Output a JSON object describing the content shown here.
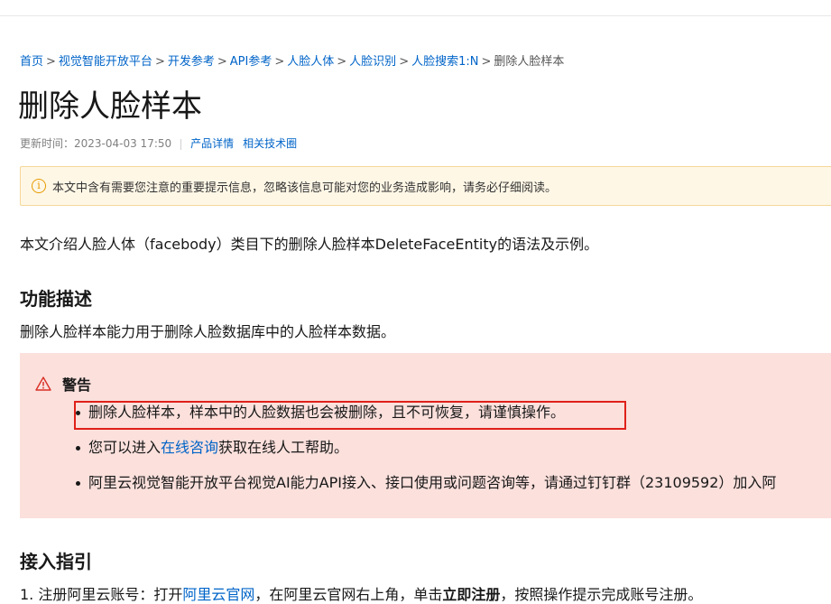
{
  "breadcrumb": {
    "items": [
      "首页",
      "视觉智能开放平台",
      "开发参考",
      "API参考",
      "人脸人体",
      "人脸识别",
      "人脸搜索1:N"
    ],
    "separator": ">",
    "current": "删除人脸样本"
  },
  "page": {
    "title": "删除人脸样本",
    "updated": "更新时间：2023-04-03 17:50",
    "links": [
      "产品详情",
      "相关技术圈"
    ]
  },
  "notice": {
    "text": "本文中含有需要您注意的重要提示信息，忽略该信息可能对您的业务造成影响，请务必仔细阅读。",
    "icon": "info-circle-icon"
  },
  "intro": "本文介绍人脸人体（facebody）类目下的删除人脸样本DeleteFaceEntity的语法及示例。",
  "section_function": {
    "heading": "功能描述",
    "desc": "删除人脸样本能力用于删除人脸数据库中的人脸样本数据。"
  },
  "warning": {
    "title": "警告",
    "icon": "warning-triangle-icon",
    "item1": "删除人脸样本，样本中的人脸数据也会被删除，且不可恢复，请谨慎操作。",
    "item2_prefix": "您可以进入",
    "item2_link": "在线咨询",
    "item2_suffix": "获取在线人工帮助。",
    "item3": "阿里云视觉智能开放平台视觉AI能力API接入、接口使用或问题咨询等，请通过钉钉群（23109592）加入阿"
  },
  "section_guide": {
    "heading": "接入指引",
    "step1_a": "1. 注册阿里云账号：打开",
    "step1_link": "阿里云官网",
    "step1_b": "，在阿里云官网右上角，单击",
    "step1_bold": "立即注册",
    "step1_c": "，按照操作提示完成账号注册。"
  },
  "colors": {
    "link": "#0064c8",
    "warning_bg": "#fbe0dc",
    "notice_bg": "#fff7e6",
    "highlight_border": "#e0201a"
  }
}
